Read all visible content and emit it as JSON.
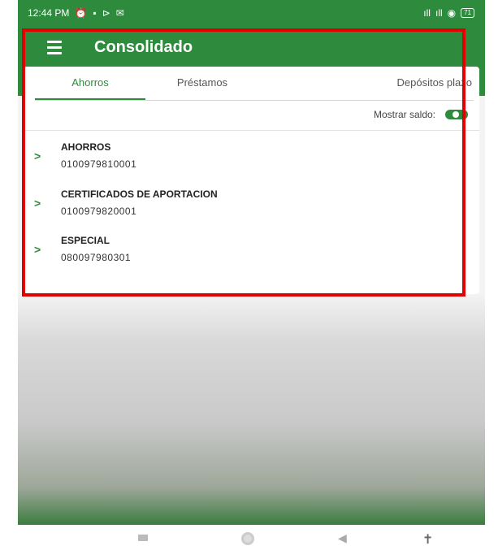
{
  "status_bar": {
    "time": "12:44 PM",
    "left_icons": [
      "alarm-icon",
      "message-icon",
      "cast-icon",
      "mail-icon"
    ],
    "right_icons": [
      "signal-icon",
      "signal-icon",
      "wifi-icon"
    ],
    "battery": "71"
  },
  "appbar": {
    "title": "Consolidado"
  },
  "tabs": [
    {
      "label": "Ahorros",
      "active": true
    },
    {
      "label": "Préstamos",
      "active": false
    },
    {
      "label": "Depósitos plazo",
      "active": false
    }
  ],
  "balance": {
    "label": "Mostrar saldo:",
    "toggle_on": true
  },
  "accounts": [
    {
      "name": "AHORROS",
      "number": "0100979810001"
    },
    {
      "name": "CERTIFICADOS DE APORTACION",
      "number": "0100979820001"
    },
    {
      "name": "ESPECIAL",
      "number": "080097980301"
    }
  ],
  "colors": {
    "primary": "#2e8b3d",
    "highlight": "#e00000"
  }
}
